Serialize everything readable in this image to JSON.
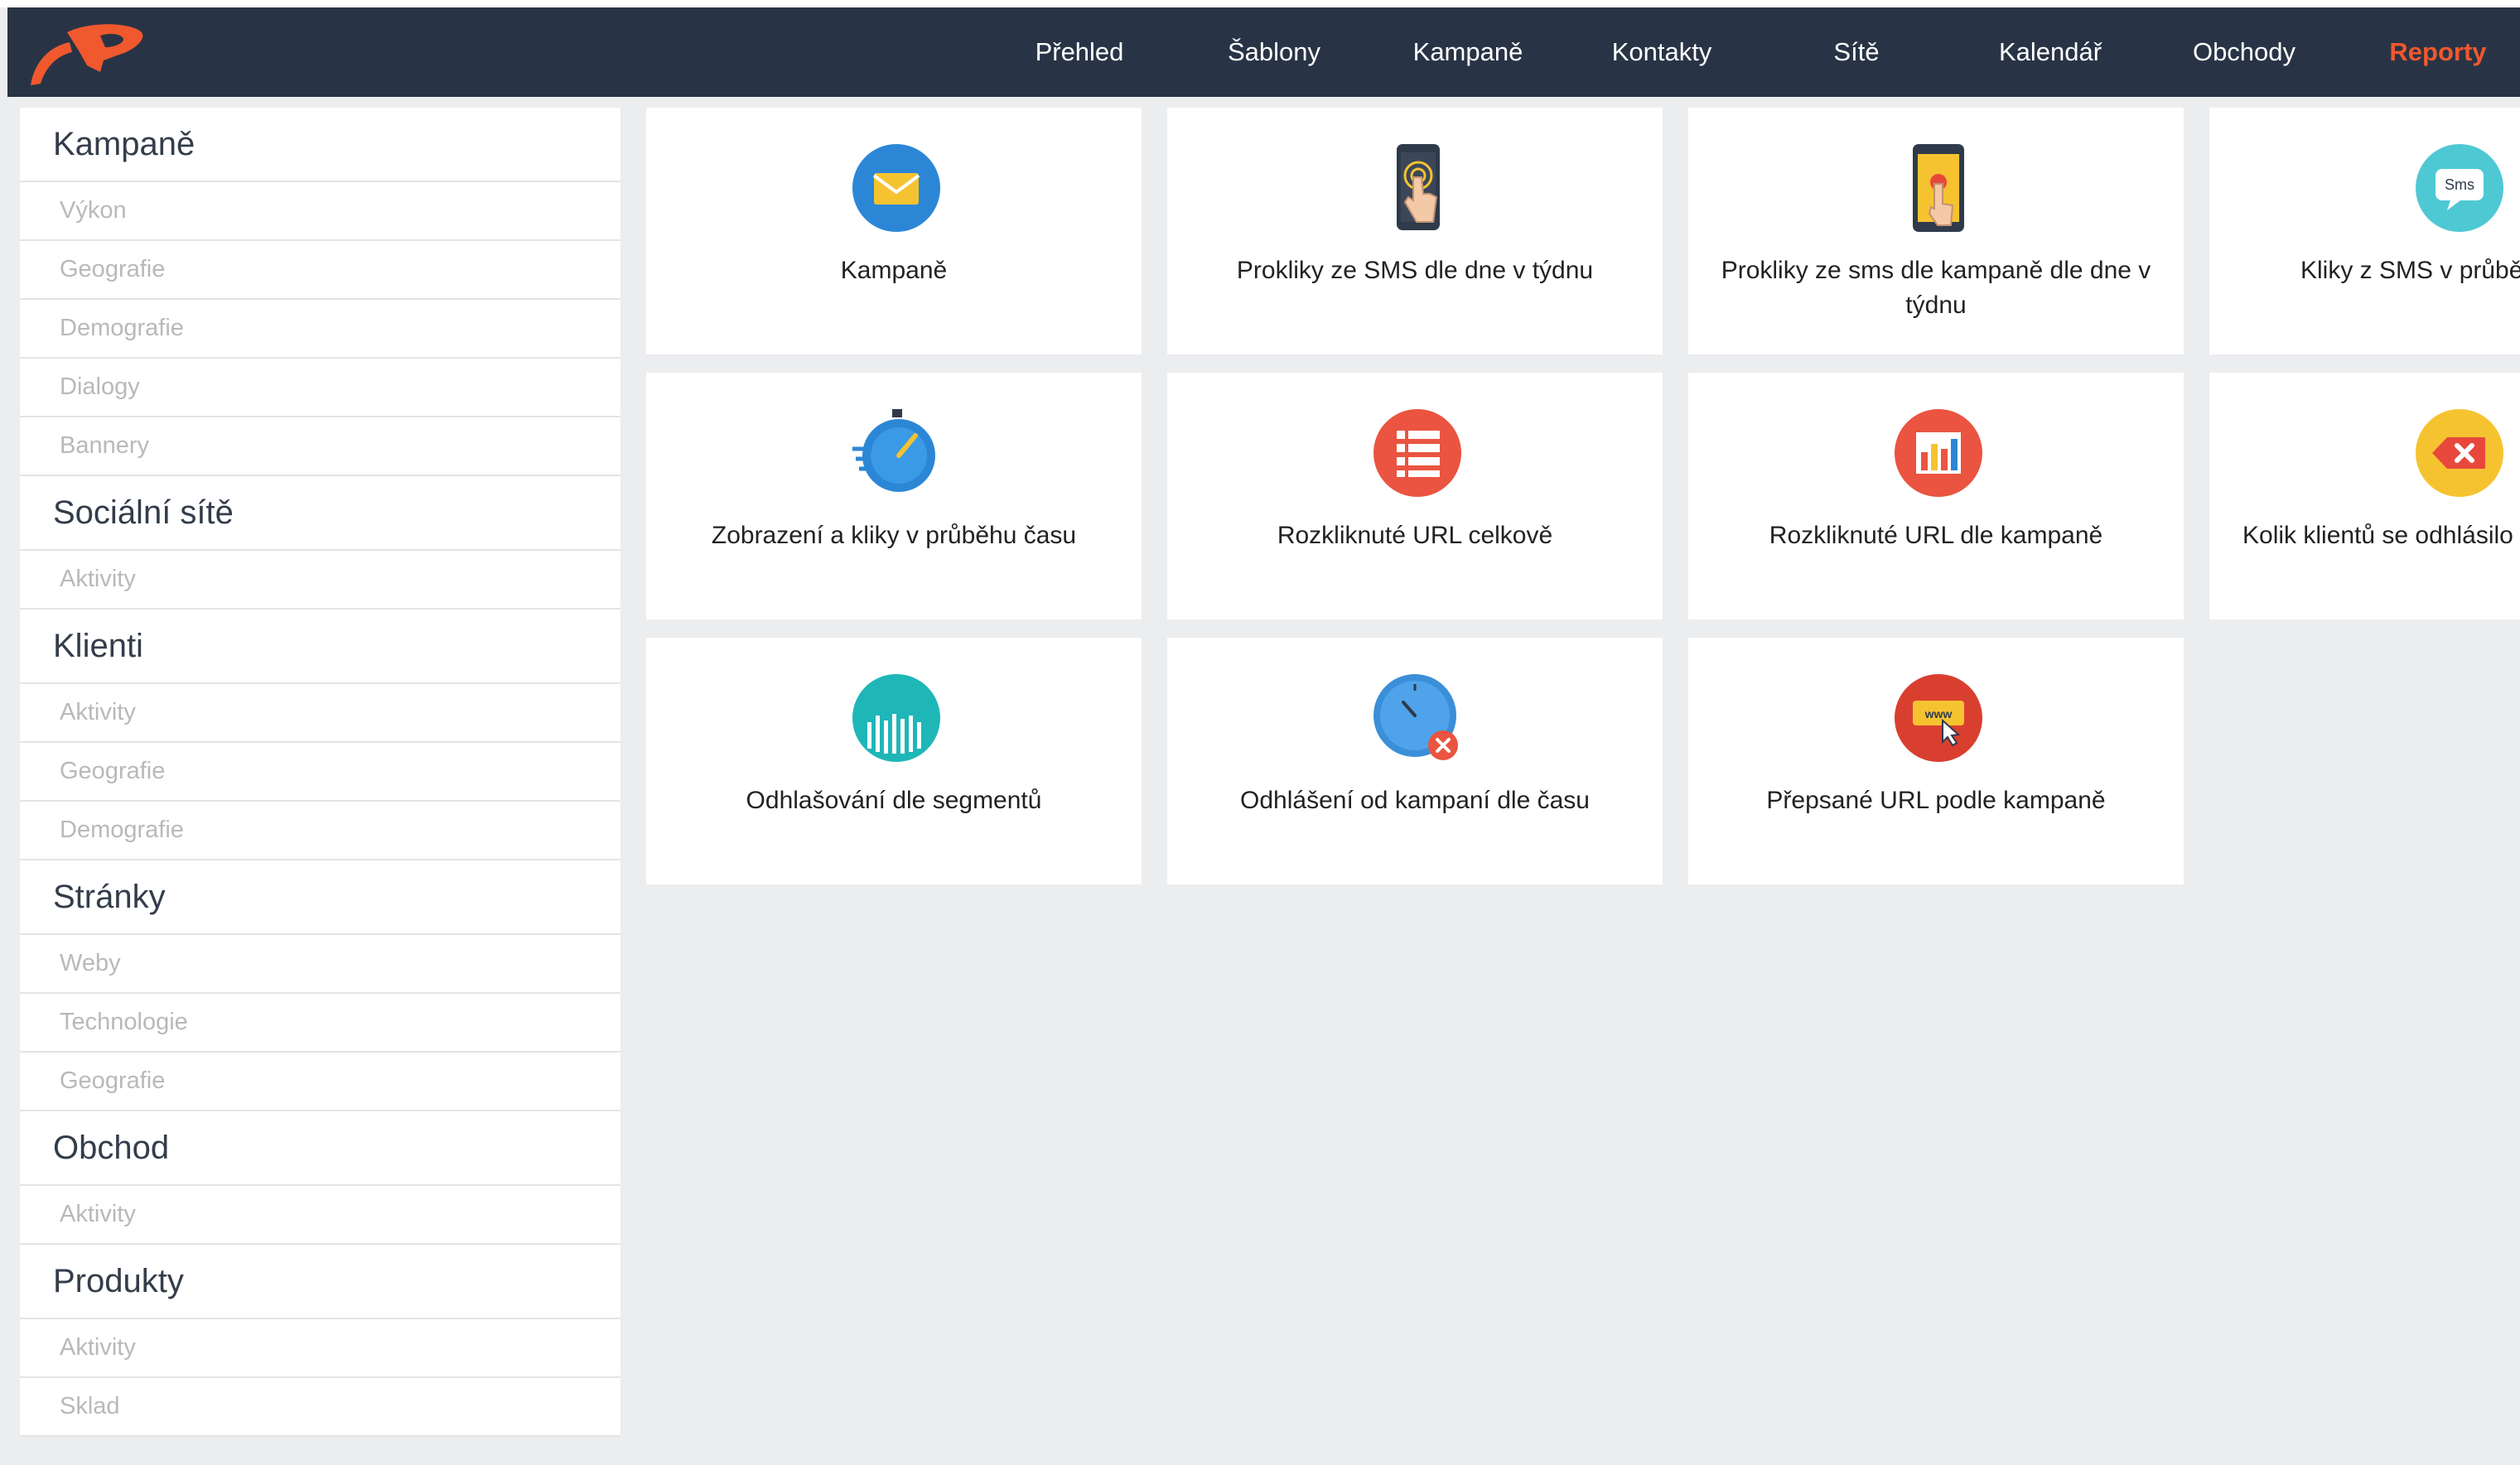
{
  "nav": {
    "items": [
      "Přehled",
      "Šablony",
      "Kampaně",
      "Kontakty",
      "Sítě",
      "Kalendář",
      "Obchody",
      "Reporty"
    ],
    "active": "Reporty"
  },
  "sidebar": {
    "sections": [
      {
        "title": "Kampaně",
        "items": [
          "Výkon",
          "Geografie",
          "Demografie",
          "Dialogy",
          "Bannery"
        ]
      },
      {
        "title": "Sociální sítě",
        "items": [
          "Aktivity"
        ]
      },
      {
        "title": "Klienti",
        "items": [
          "Aktivity",
          "Geografie",
          "Demografie"
        ]
      },
      {
        "title": "Stránky",
        "items": [
          "Weby",
          "Technologie",
          "Geografie"
        ]
      },
      {
        "title": "Obchod",
        "items": [
          "Aktivity"
        ]
      },
      {
        "title": "Produkty",
        "items": [
          "Aktivity",
          "Sklad"
        ]
      }
    ]
  },
  "reports": [
    {
      "label": "Kampaně",
      "icon": "envelope-icon"
    },
    {
      "label": "Prokliky ze SMS dle dne v týdnu",
      "icon": "phone-tap-icon"
    },
    {
      "label": "Prokliky ze sms dle kampaně dle dne v týdnu",
      "icon": "phone-yellow-icon"
    },
    {
      "label": "Kliky z SMS v průbě",
      "icon": "sms-bubble-icon"
    },
    {
      "label": "Zobrazení a kliky v průběhu času",
      "icon": "stopwatch-icon"
    },
    {
      "label": "Rozkliknuté URL celkově",
      "icon": "list-icon"
    },
    {
      "label": "Rozkliknuté URL dle kampaně",
      "icon": "bar-chart-icon"
    },
    {
      "label": "Kolik klientů se odhlásilo",
      "icon": "delete-key-icon"
    },
    {
      "label": "Odhlašování dle segmentů",
      "icon": "segments-icon"
    },
    {
      "label": "Odhlášení od kampaní dle času",
      "icon": "clock-cancel-icon"
    },
    {
      "label": "Přepsané URL podle kampaně",
      "icon": "www-icon"
    }
  ],
  "colors": {
    "navbar": "#283446",
    "active_nav": "#f0582e",
    "background": "#ecedef"
  }
}
